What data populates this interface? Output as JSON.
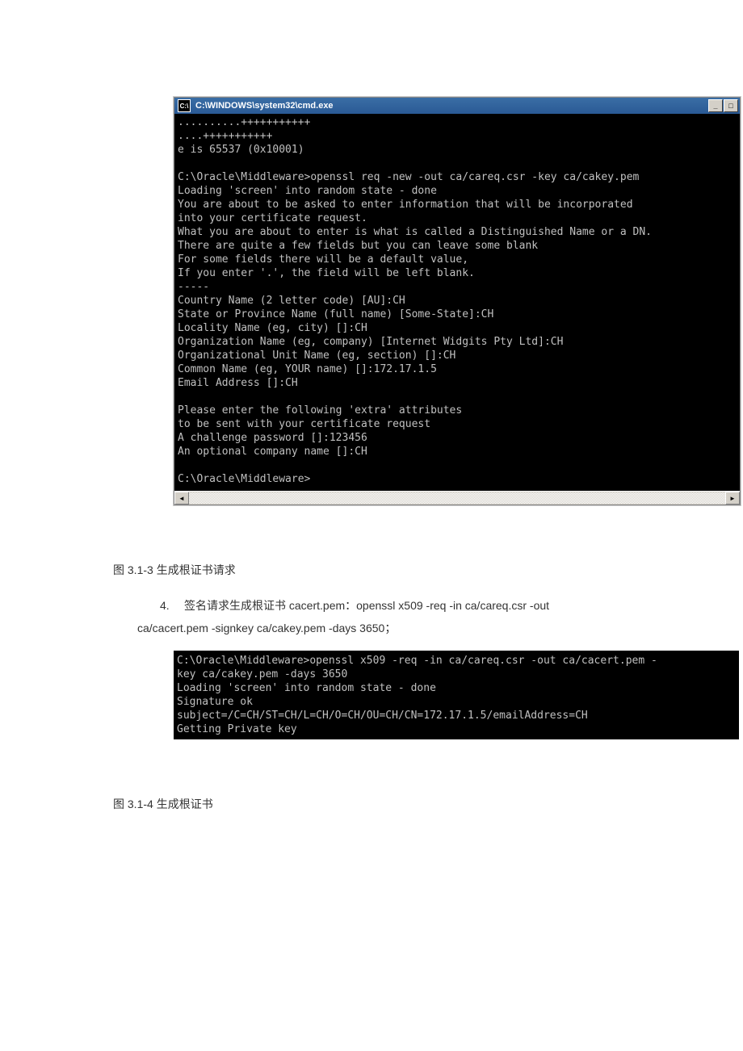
{
  "cmd_window": {
    "icon_label": "C:\\",
    "title": "C:\\WINDOWS\\system32\\cmd.exe",
    "btn_minimize": "_",
    "btn_maximize": "□",
    "terminal_lines": "..........+++++++++++\n....+++++++++++\ne is 65537 (0x10001)\n\nC:\\Oracle\\Middleware>openssl req -new -out ca/careq.csr -key ca/cakey.pem\nLoading 'screen' into random state - done\nYou are about to be asked to enter information that will be incorporated\ninto your certificate request.\nWhat you are about to enter is what is called a Distinguished Name or a DN.\nThere are quite a few fields but you can leave some blank\nFor some fields there will be a default value,\nIf you enter '.', the field will be left blank.\n-----\nCountry Name (2 letter code) [AU]:CH\nState or Province Name (full name) [Some-State]:CH\nLocality Name (eg, city) []:CH\nOrganization Name (eg, company) [Internet Widgits Pty Ltd]:CH\nOrganizational Unit Name (eg, section) []:CH\nCommon Name (eg, YOUR name) []:172.17.1.5\nEmail Address []:CH\n\nPlease enter the following 'extra' attributes\nto be sent with your certificate request\nA challenge password []:123456\nAn optional company name []:CH\n\nC:\\Oracle\\Middleware>\n",
    "scroll_left": "◄",
    "scroll_right": "►"
  },
  "caption1": "图 3.1-3 生成根证书请求",
  "step4": {
    "num": "4.",
    "text1": "签名请求生成根证书 cacert.pem：openssl x509 -req -in ca/careq.csr -out",
    "text2": "ca/cacert.pem -signkey ca/cakey.pem -days 3650；"
  },
  "terminal2_lines": "C:\\Oracle\\Middleware>openssl x509 -req -in ca/careq.csr -out ca/cacert.pem -\nkey ca/cakey.pem -days 3650\nLoading 'screen' into random state - done\nSignature ok\nsubject=/C=CH/ST=CH/L=CH/O=CH/OU=CH/CN=172.17.1.5/emailAddress=CH\nGetting Private key",
  "caption2": "图 3.1-4 生成根证书"
}
